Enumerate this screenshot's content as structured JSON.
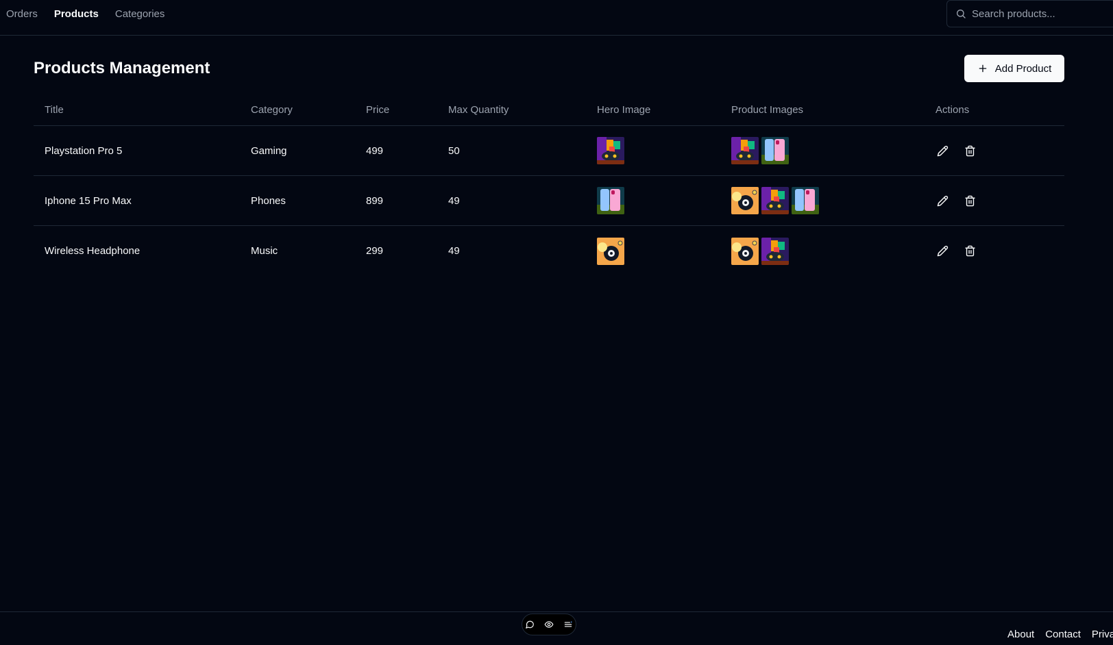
{
  "nav": {
    "items": [
      {
        "label": "Orders"
      },
      {
        "label": "Products"
      },
      {
        "label": "Categories"
      }
    ]
  },
  "search": {
    "placeholder": "Search products..."
  },
  "page": {
    "title": "Products Management",
    "add_button_label": "Add Product"
  },
  "table": {
    "headers": [
      "Title",
      "Category",
      "Price",
      "Max Quantity",
      "Hero Image",
      "Product Images",
      "Actions"
    ],
    "rows": [
      {
        "title": "Playstation Pro 5",
        "category": "Gaming",
        "price": "499",
        "max_quantity": "50",
        "hero": "gaming",
        "images": [
          "gaming",
          "phone"
        ]
      },
      {
        "title": "Iphone 15 Pro Max",
        "category": "Phones",
        "price": "899",
        "max_quantity": "49",
        "hero": "phone",
        "images": [
          "headphone",
          "gaming",
          "phone"
        ]
      },
      {
        "title": "Wireless Headphone",
        "category": "Music",
        "price": "299",
        "max_quantity": "49",
        "hero": "headphone",
        "images": [
          "headphone",
          "gaming"
        ]
      }
    ]
  },
  "toolbar_icons": [
    "chat-icon",
    "eye-icon",
    "list-icon"
  ],
  "footer": {
    "links": [
      "About",
      "Contact",
      "Priva"
    ]
  },
  "colors": {
    "background": "#030712",
    "border": "#1f2937",
    "muted": "#9ca3af",
    "text": "#f9fafb"
  }
}
